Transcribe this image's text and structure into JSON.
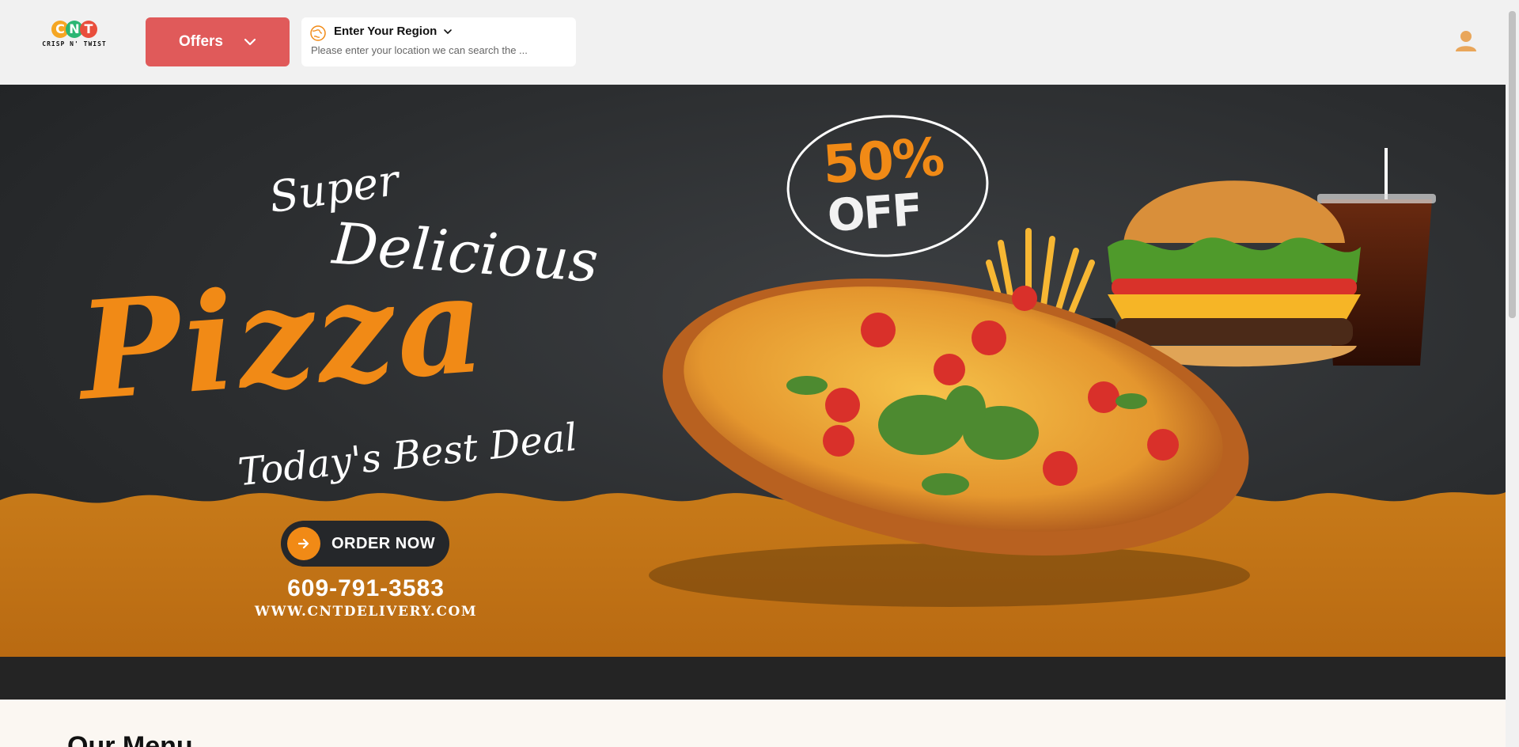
{
  "header": {
    "logo": {
      "letters": [
        "C",
        "N",
        "T"
      ],
      "subtitle": "CRISP N' TWIST",
      "icon": "logo-icon"
    },
    "offers_label": "Offers",
    "region": {
      "title": "Enter Your Region",
      "placeholder": "Please enter your location we can search the ..."
    }
  },
  "banner": {
    "headline_super": "Super",
    "headline_delicious": "Delicious",
    "headline_pizza": "Pizza",
    "headline_deal": "Today's Best Deal",
    "discount_percent": "50%",
    "discount_off": "OFF",
    "order_label": "ORDER NOW",
    "phone": "609-791-3583",
    "website": "WWW.CNTDELIVERY.COM"
  },
  "menu": {
    "title": "Our Menu"
  },
  "colors": {
    "accent": "#f18a16",
    "offers_button": "#e05a5a",
    "banner_bg": "#2b2d2f",
    "floor": "#c97a17"
  }
}
